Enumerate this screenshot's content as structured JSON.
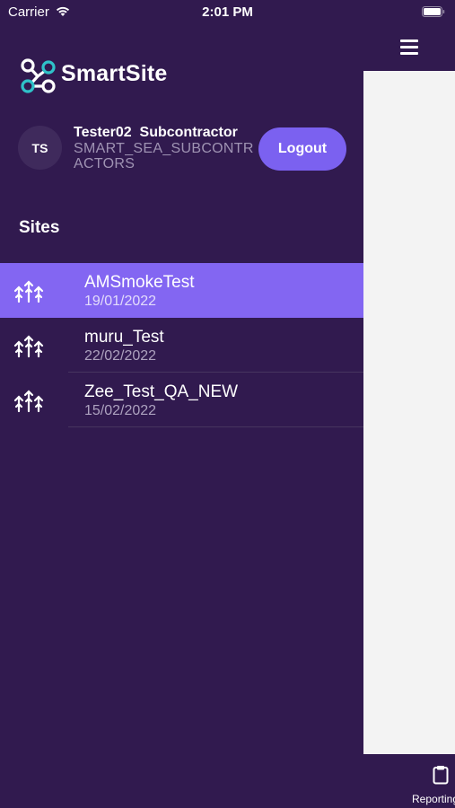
{
  "status_bar": {
    "carrier": "Carrier",
    "time": "2:01 PM"
  },
  "brand": {
    "name": "SmartSite",
    "accent_color": "#2fc2c9"
  },
  "user": {
    "initials": "TS",
    "name": "Tester02  Subcontractor",
    "role": "SMART_SEA_SUBCONTRACTORS",
    "logout_label": "Logout"
  },
  "sites": {
    "heading": "Sites",
    "items": [
      {
        "name": "AMSmokeTest",
        "date": "19/01/2022",
        "selected": true
      },
      {
        "name": "muru_Test",
        "date": "22/02/2022",
        "selected": false
      },
      {
        "name": "Zee_Test_QA_NEW",
        "date": "15/02/2022",
        "selected": false
      }
    ]
  },
  "tabbar": {
    "reporting_label": "Reporting"
  },
  "colors": {
    "background": "#311a4f",
    "selected_row": "#8366f2",
    "logout_button": "#7b61f0",
    "content_pane": "#f3f3f3"
  }
}
